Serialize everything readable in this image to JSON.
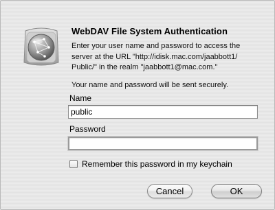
{
  "dialog": {
    "title": "WebDAV File System Authentication",
    "message_lines": [
      "Enter your user name and password to access the",
      "server at the URL \"http://idisk.mac.com/jaabbott1/",
      "Public/\" in the realm \"jaabbott1@mac.com.\""
    ],
    "secure_note": "Your name and password will be sent securely.",
    "icon": "network-globe-icon"
  },
  "fields": {
    "name_label": "Name",
    "name_value": "public",
    "password_label": "Password",
    "password_value": ""
  },
  "keychain": {
    "label": "Remember this password in my keychain",
    "checked": false
  },
  "buttons": {
    "cancel_label": "Cancel",
    "ok_label": "OK"
  }
}
